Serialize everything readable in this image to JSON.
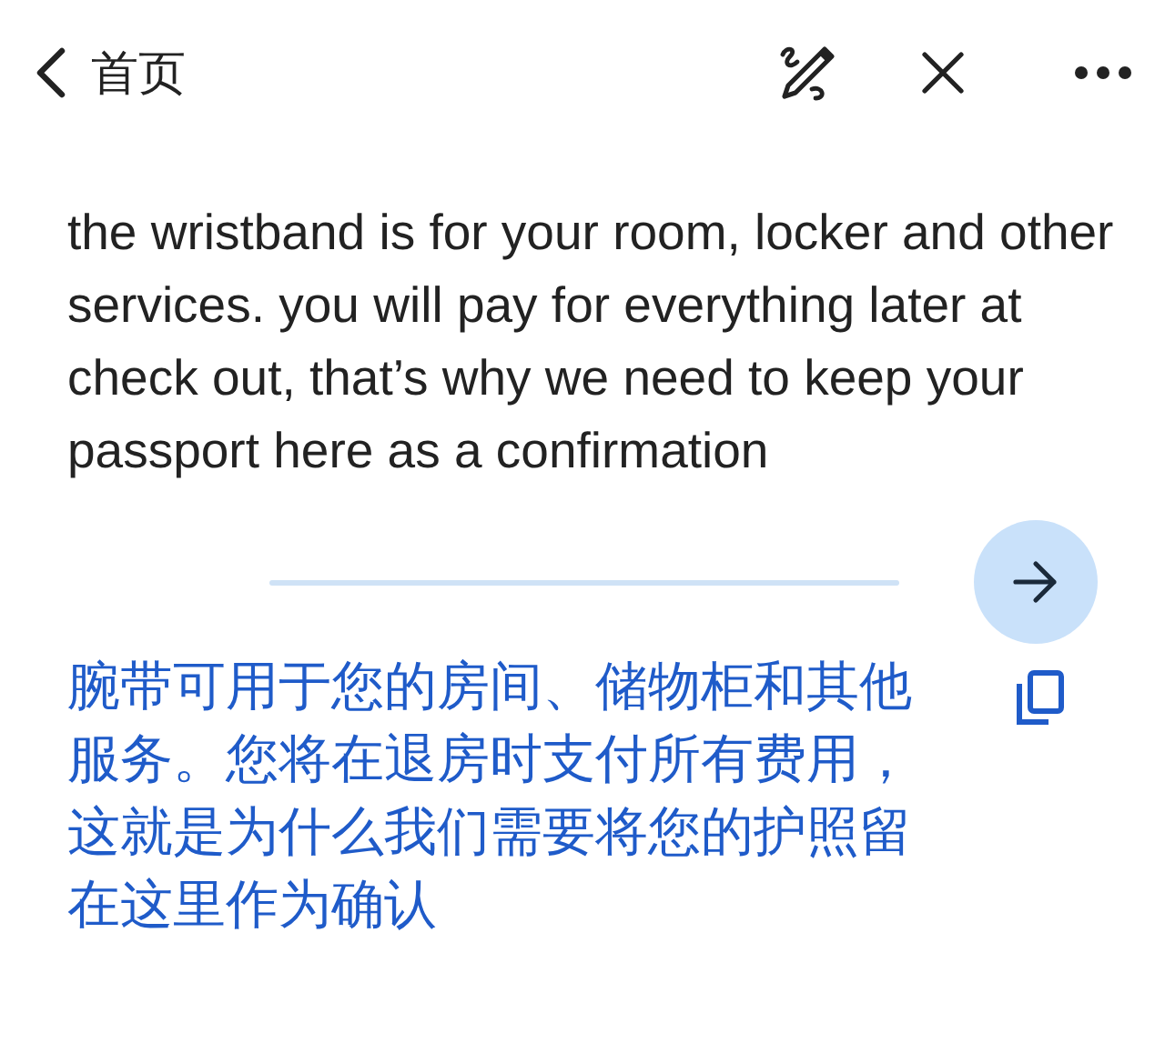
{
  "header": {
    "back_label": "首页"
  },
  "source": {
    "text": "the wristband is for your room, locker and other services. you will pay for everything later at check out, that’s why we need to keep your passport here as a confirmation"
  },
  "translation": {
    "text": "腕带可用于您的房间、储物柜和其他服务。您将在退房时支付所有费用，这就是为什么我们需要将您的护照留在这里作为确认"
  }
}
